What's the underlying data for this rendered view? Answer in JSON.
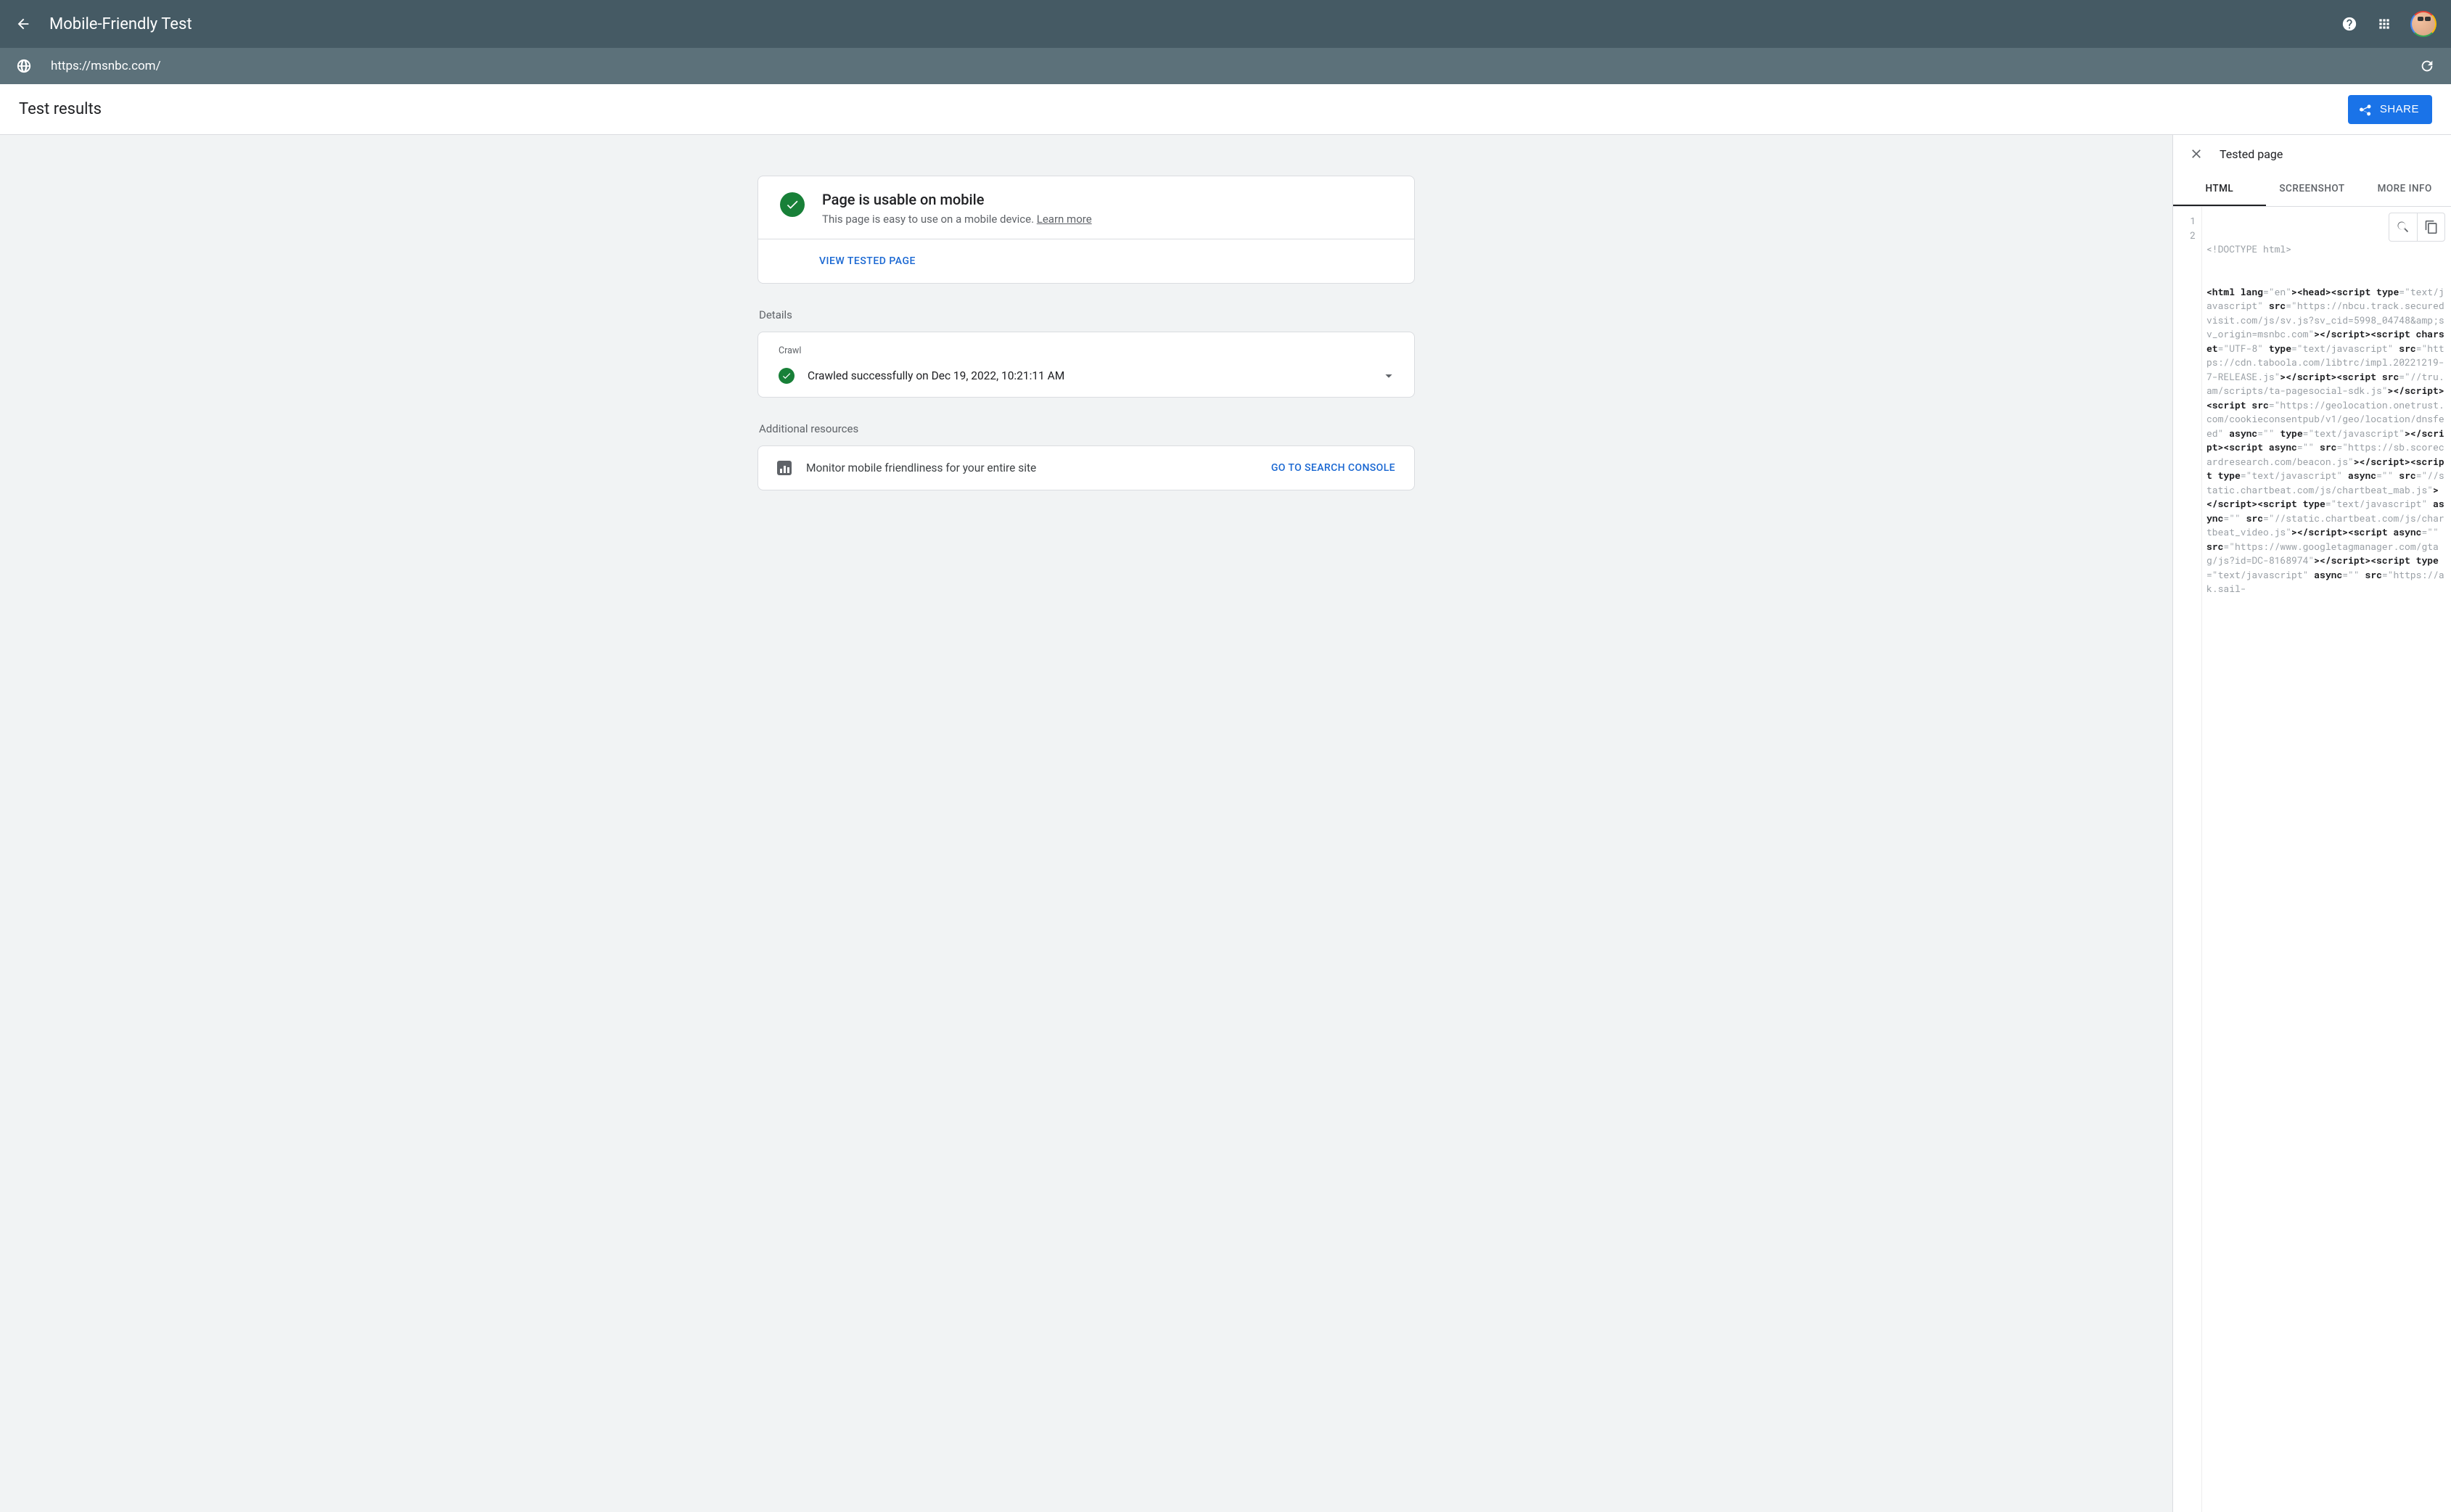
{
  "header": {
    "title": "Mobile-Friendly Test"
  },
  "url_bar": {
    "url": "https://msnbc.com/"
  },
  "subheader": {
    "title": "Test results",
    "share_label": "SHARE"
  },
  "status": {
    "title": "Page is usable on mobile",
    "subtitle_prefix": "This page is easy to use on a mobile device. ",
    "learn_more": "Learn more",
    "view_tested": "VIEW TESTED PAGE"
  },
  "details": {
    "section_label": "Details",
    "crawl_label": "Crawl",
    "crawl_text": "Crawled successfully on Dec 19, 2022, 10:21:11 AM"
  },
  "resources": {
    "section_label": "Additional resources",
    "monitor_text": "Monitor mobile friendliness for your entire site",
    "goto_label": "GO TO SEARCH CONSOLE"
  },
  "side": {
    "title": "Tested page",
    "tabs": {
      "html": "HTML",
      "screenshot": "SCREENSHOT",
      "more": "MORE INFO"
    },
    "gutter": [
      "1",
      "2"
    ],
    "code_line1": "<!DOCTYPE html>",
    "code_tokens": [
      {
        "b": "<html lang"
      },
      {
        "t": "=\"en\""
      },
      {
        "b": "><head><script type"
      },
      {
        "t": "=\"text/javascript\" "
      },
      {
        "b": "src"
      },
      {
        "t": "=\"https://nbcu.track.securedvisit.com/js/sv.js?sv_cid=5998_04748&amp;sv_origin=msnbc.com\""
      },
      {
        "b": "></script><script charset"
      },
      {
        "t": "=\"UTF-8\" "
      },
      {
        "b": "type"
      },
      {
        "t": "=\"text/javascript\" "
      },
      {
        "b": "src"
      },
      {
        "t": "=\"https://cdn.taboola.com/libtrc/impl.20221219-7-RELEASE.js\""
      },
      {
        "b": "></script><script src"
      },
      {
        "t": "=\"//tru.am/scripts/ta-pagesocial-sdk.js\""
      },
      {
        "b": "></script><script src"
      },
      {
        "t": "=\"https://geolocation.onetrust.com/cookieconsentpub/v1/geo/location/dnsfeed\" "
      },
      {
        "b": "async"
      },
      {
        "t": "=\"\" "
      },
      {
        "b": "type"
      },
      {
        "t": "=\"text/javascript\""
      },
      {
        "b": "></script><script async"
      },
      {
        "t": "=\"\" "
      },
      {
        "b": "src"
      },
      {
        "t": "=\"https://sb.scorecardresearch.com/beacon.js\""
      },
      {
        "b": "></script><script type"
      },
      {
        "t": "=\"text/javascript\" "
      },
      {
        "b": "async"
      },
      {
        "t": "=\"\" "
      },
      {
        "b": "src"
      },
      {
        "t": "=\"//static.chartbeat.com/js/chartbeat_mab.js\""
      },
      {
        "b": "></script><script type"
      },
      {
        "t": "=\"text/javascript\" "
      },
      {
        "b": "async"
      },
      {
        "t": "=\"\" "
      },
      {
        "b": "src"
      },
      {
        "t": "=\"//static.chartbeat.com/js/chartbeat_video.js\""
      },
      {
        "b": "></script><script async"
      },
      {
        "t": "=\"\" "
      },
      {
        "b": "src"
      },
      {
        "t": "=\"https://www.googletagmanager.com/gtag/js?id=DC-8168974\""
      },
      {
        "b": "></script><script type"
      },
      {
        "t": "=\"text/javascript\" "
      },
      {
        "b": "async"
      },
      {
        "t": "=\"\" "
      },
      {
        "b": "src"
      },
      {
        "t": "=\"https://ak.sail-"
      }
    ]
  }
}
